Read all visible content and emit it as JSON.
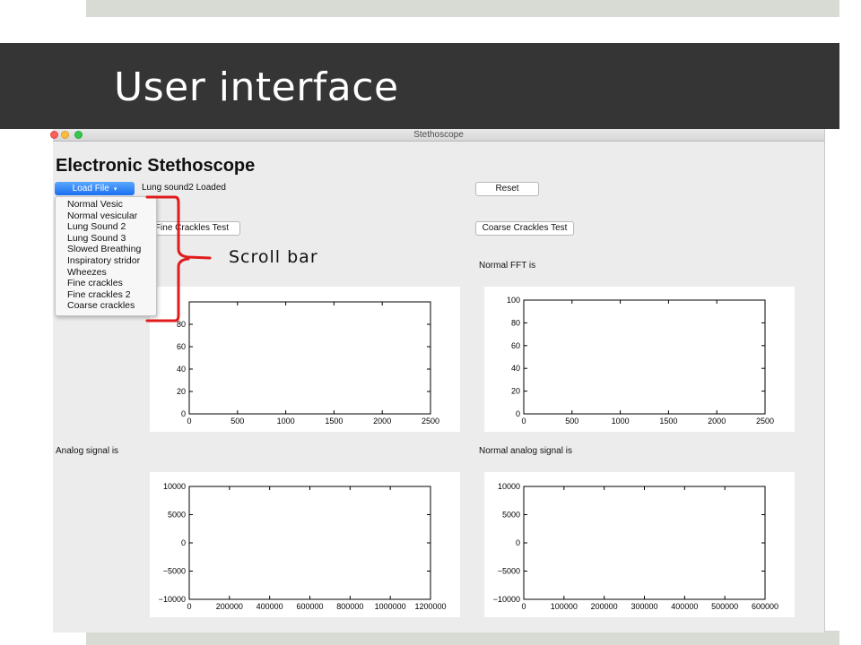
{
  "slide": {
    "title": "User interface"
  },
  "annotation": {
    "label": "Scroll bar",
    "color": "#e01b1b"
  },
  "window": {
    "title": "Stethoscope",
    "heading": "Electronic Stethoscope",
    "load_button": {
      "label": "Load File",
      "caret": "▾"
    },
    "status": "Lung sound2 Loaded",
    "reset_button": "Reset",
    "fine_crackles_button": "Fine Crackles Test",
    "coarse_crackles_button": "Coarse Crackles Test",
    "normal_fft_label": "Normal FFT is",
    "analog_label": "Analog signal is",
    "normal_analog_label": "Normal analog signal is",
    "dropdown": {
      "items": [
        "Normal Vesic",
        "Normal vesicular",
        "Lung Sound 2",
        "Lung Sound 3",
        "Slowed Breathing",
        "Inspiratory stridor",
        "Wheezes",
        "Fine crackles",
        "Fine crackles 2",
        "Coarse crackles"
      ]
    }
  },
  "chart_data": [
    {
      "type": "line",
      "name": "fft",
      "xlim": [
        0,
        2500
      ],
      "ylim": [
        0,
        100
      ],
      "xticks": [
        "0",
        "500",
        "1000",
        "1500",
        "2000",
        "2500"
      ],
      "yticks": [
        "0",
        "20",
        "40",
        "60",
        "80"
      ],
      "series": []
    },
    {
      "type": "line",
      "name": "normal_fft",
      "xlim": [
        0,
        2500
      ],
      "ylim": [
        0,
        100
      ],
      "xticks": [
        "0",
        "500",
        "1000",
        "1500",
        "2000",
        "2500"
      ],
      "yticks": [
        "0",
        "20",
        "40",
        "60",
        "80",
        "100"
      ],
      "series": []
    },
    {
      "type": "line",
      "name": "analog",
      "xlim": [
        0,
        1200000
      ],
      "ylim": [
        -10000,
        10000
      ],
      "xticks": [
        "0",
        "200000",
        "400000",
        "600000",
        "800000",
        "1000000",
        "1200000"
      ],
      "yticks": [
        "−10000",
        "−5000",
        "0",
        "5000",
        "10000"
      ],
      "series": []
    },
    {
      "type": "line",
      "name": "normal_analog",
      "xlim": [
        0,
        600000
      ],
      "ylim": [
        -10000,
        10000
      ],
      "xticks": [
        "0",
        "100000",
        "200000",
        "300000",
        "400000",
        "500000",
        "600000"
      ],
      "yticks": [
        "−10000",
        "−5000",
        "0",
        "5000",
        "10000"
      ],
      "series": []
    }
  ]
}
